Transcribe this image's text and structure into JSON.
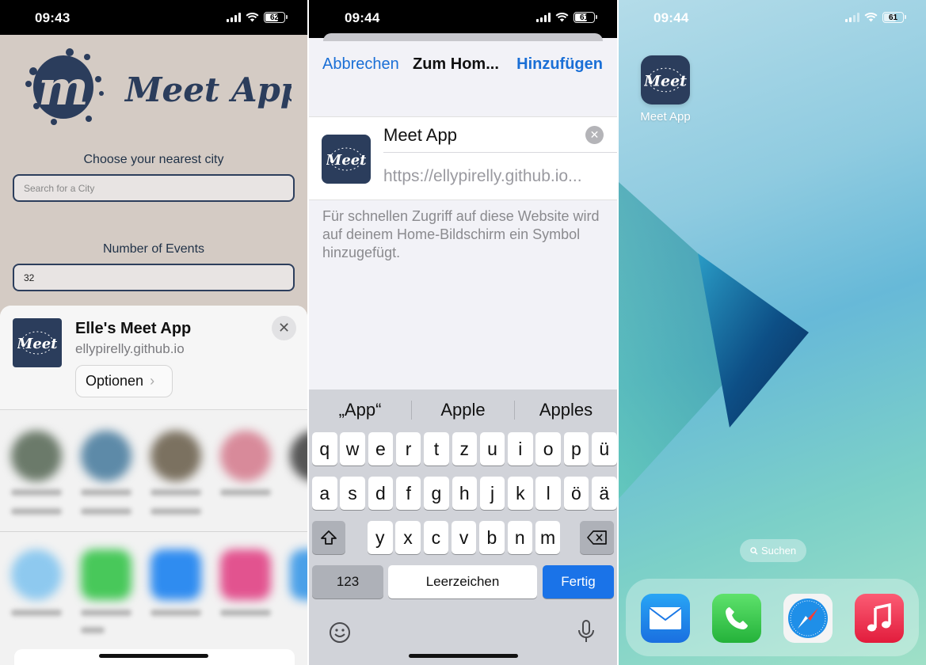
{
  "panel1": {
    "status": {
      "time": "09:43",
      "battery": "62"
    },
    "logo_text": "Meet App",
    "city_label": "Choose your nearest city",
    "city_placeholder": "Search for a City",
    "events_label": "Number of Events",
    "events_value": "32",
    "share_sheet": {
      "title": "Elle's Meet App",
      "subtitle": "ellypirelly.github.io",
      "options_label": "Optionen",
      "close_icon": "close-icon"
    }
  },
  "panel2": {
    "status": {
      "time": "09:44",
      "battery": "61"
    },
    "nav": {
      "cancel": "Abbrechen",
      "title": "Zum Hom...",
      "add": "Hinzufügen"
    },
    "name_value": "Meet App",
    "url_value": "https://ellypirelly.github.io...",
    "hint": "Für schnellen Zugriff auf diese Website wird auf deinem Home-Bildschirm ein Symbol hinzugefügt.",
    "suggestions": [
      "„App“",
      "Apple",
      "Apples"
    ],
    "keys": {
      "row1": [
        "q",
        "w",
        "e",
        "r",
        "t",
        "z",
        "u",
        "i",
        "o",
        "p",
        "ü"
      ],
      "row2": [
        "a",
        "s",
        "d",
        "f",
        "g",
        "h",
        "j",
        "k",
        "l",
        "ö",
        "ä"
      ],
      "row3": [
        "y",
        "x",
        "c",
        "v",
        "b",
        "n",
        "m"
      ],
      "numbers": "123",
      "space": "Leerzeichen",
      "done": "Fertig"
    }
  },
  "panel3": {
    "status": {
      "time": "09:44",
      "battery": "61"
    },
    "app_label": "Meet App",
    "search_label": "Suchen",
    "dock": [
      "mail-icon",
      "phone-icon",
      "safari-icon",
      "music-icon"
    ]
  },
  "colors": {
    "accent_blue": "#1a6fd6",
    "logo_navy": "#2b3d5c",
    "panel1_bg": "#d4cbc4"
  }
}
